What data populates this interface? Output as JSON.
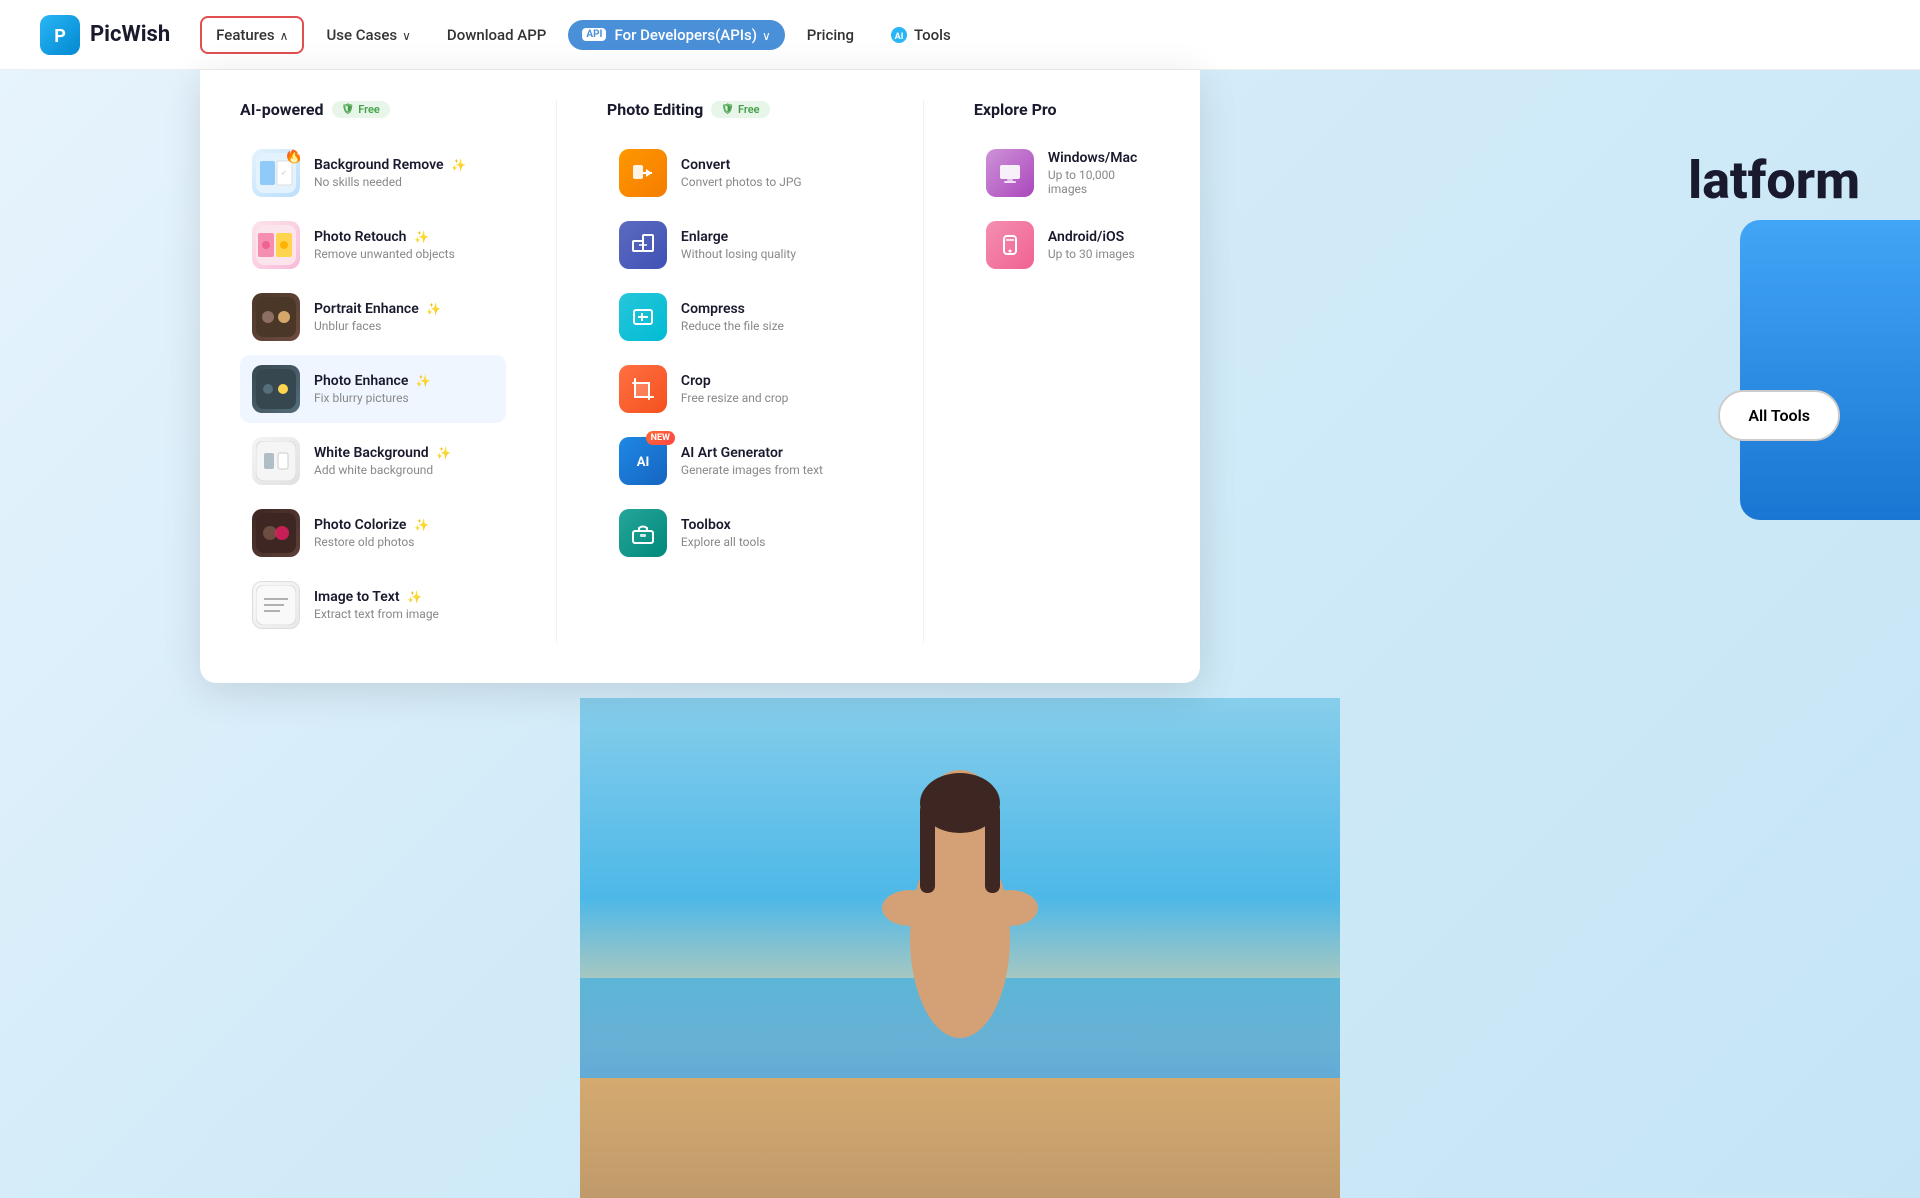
{
  "logo": {
    "text": "PicWish"
  },
  "navbar": {
    "features_label": "Features",
    "use_cases_label": "Use Cases",
    "download_app_label": "Download APP",
    "for_developers_label": "For Developers(APIs)",
    "api_badge": "API",
    "pricing_label": "Pricing",
    "tools_label": "Tools"
  },
  "dropdown": {
    "ai_powered": {
      "header": "AI-powered",
      "free_badge": "Free",
      "items": [
        {
          "title": "Background Remove",
          "subtitle": "No skills needed",
          "badge": "hot",
          "icon_type": "thumb_bg_remove"
        },
        {
          "title": "Photo Retouch",
          "subtitle": "Remove unwanted objects",
          "badge": "",
          "icon_type": "thumb_retouch"
        },
        {
          "title": "Portrait Enhance",
          "subtitle": "Unblur faces",
          "badge": "",
          "icon_type": "thumb_portrait"
        },
        {
          "title": "Photo Enhance",
          "subtitle": "Fix blurry pictures",
          "badge": "",
          "icon_type": "thumb_enhance",
          "highlighted": true
        },
        {
          "title": "White Background",
          "subtitle": "Add white background",
          "badge": "",
          "icon_type": "thumb_white_bg"
        },
        {
          "title": "Photo Colorize",
          "subtitle": "Restore old photos",
          "badge": "",
          "icon_type": "thumb_colorize"
        },
        {
          "title": "Image to Text",
          "subtitle": "Extract text from image",
          "badge": "",
          "icon_type": "thumb_image_text"
        }
      ]
    },
    "photo_editing": {
      "header": "Photo Editing",
      "free_badge": "Free",
      "items": [
        {
          "title": "Convert",
          "subtitle": "Convert photos to JPG",
          "icon_color": "convert"
        },
        {
          "title": "Enlarge",
          "subtitle": "Without losing quality",
          "icon_color": "enlarge"
        },
        {
          "title": "Compress",
          "subtitle": "Reduce the file size",
          "icon_color": "compress"
        },
        {
          "title": "Crop",
          "subtitle": "Free resize and crop",
          "icon_color": "crop"
        },
        {
          "title": "AI Art Generator",
          "subtitle": "Generate images from text",
          "icon_color": "ai",
          "badge": "new"
        },
        {
          "title": "Toolbox",
          "subtitle": "Explore all tools",
          "icon_color": "toolbox"
        }
      ]
    },
    "explore_pro": {
      "header": "Explore Pro",
      "items": [
        {
          "title": "Windows/Mac",
          "subtitle": "Up to 10,000 images",
          "icon_color": "windows"
        },
        {
          "title": "Android/iOS",
          "subtitle": "Up to 30 images",
          "icon_color": "android"
        }
      ]
    }
  },
  "hero": {
    "platform_text": "latform",
    "all_tools_label": "All Tools"
  }
}
